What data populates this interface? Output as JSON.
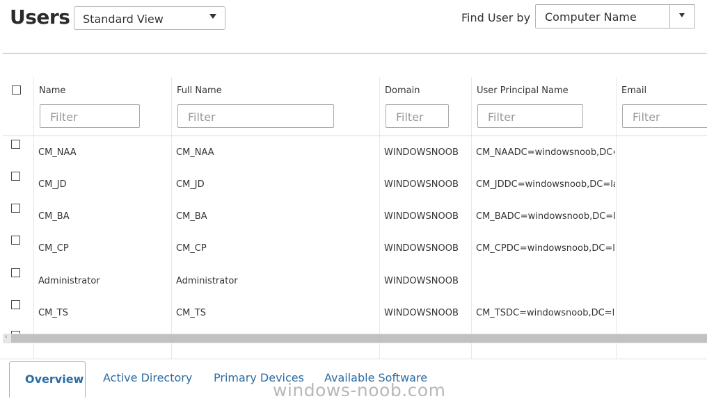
{
  "header": {
    "title": "Users",
    "view_select": "Standard View",
    "find_label": "Find User by",
    "find_select": "Computer Name"
  },
  "columns": [
    {
      "label": "Name",
      "filter_placeholder": "Filter"
    },
    {
      "label": "Full Name",
      "filter_placeholder": "Filter"
    },
    {
      "label": "Domain",
      "filter_placeholder": "Filter"
    },
    {
      "label": "User Principal Name",
      "filter_placeholder": "Filter"
    },
    {
      "label": "Email",
      "filter_placeholder": "Filter"
    }
  ],
  "rows": [
    {
      "name": "CM_NAA",
      "full_name": "CM_NAA",
      "domain": "WINDOWSNOOB",
      "upn": "CM_NAADC=windowsnoob,DC=la"
    },
    {
      "name": "CM_JD",
      "full_name": "CM_JD",
      "domain": "WINDOWSNOOB",
      "upn": "CM_JDDC=windowsnoob,DC=lab,l"
    },
    {
      "name": "CM_BA",
      "full_name": "CM_BA",
      "domain": "WINDOWSNOOB",
      "upn": "CM_BADC=windowsnoob,DC=lab,"
    },
    {
      "name": "CM_CP",
      "full_name": "CM_CP",
      "domain": "WINDOWSNOOB",
      "upn": "CM_CPDC=windowsnoob,DC=lab,"
    },
    {
      "name": "Administrator",
      "full_name": "Administrator",
      "domain": "WINDOWSNOOB",
      "upn": ""
    },
    {
      "name": "CM_TS",
      "full_name": "CM_TS",
      "domain": "WINDOWSNOOB",
      "upn": "CM_TSDC=windowsnoob,DC=lab,"
    }
  ],
  "tabs": [
    "Overview",
    "Active Directory",
    "Primary Devices",
    "Available Software"
  ],
  "watermark": "windows-noob.com"
}
